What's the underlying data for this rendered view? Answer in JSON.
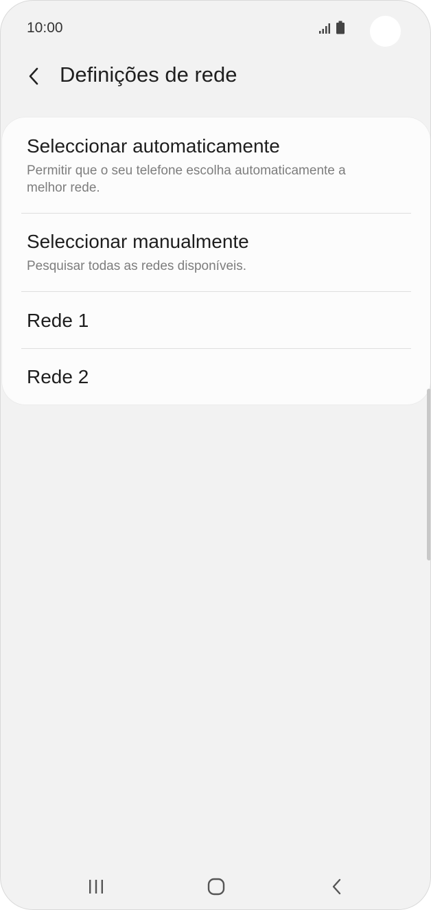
{
  "status_bar": {
    "time": "10:00",
    "icons": [
      "signal-icon",
      "battery-icon"
    ]
  },
  "header": {
    "back_icon": "chevron-left-icon",
    "title": "Definições de rede"
  },
  "list": {
    "items": [
      {
        "title": "Seleccionar automaticamente",
        "subtitle": "Permitir que o seu telefone escolha automaticamente a melhor rede."
      },
      {
        "title": "Seleccionar manualmente",
        "subtitle": "Pesquisar todas as redes disponíveis."
      },
      {
        "title": "Rede 1"
      },
      {
        "title": "Rede 2"
      }
    ]
  },
  "nav_bar": {
    "icons": [
      "recent-apps-icon",
      "home-icon",
      "back-icon"
    ]
  },
  "colors": {
    "background": "#f2f2f2",
    "card": "#fcfcfc",
    "primary_text": "#1e1e1e",
    "secondary_text": "#7d7d7d",
    "divider": "#dedede"
  }
}
